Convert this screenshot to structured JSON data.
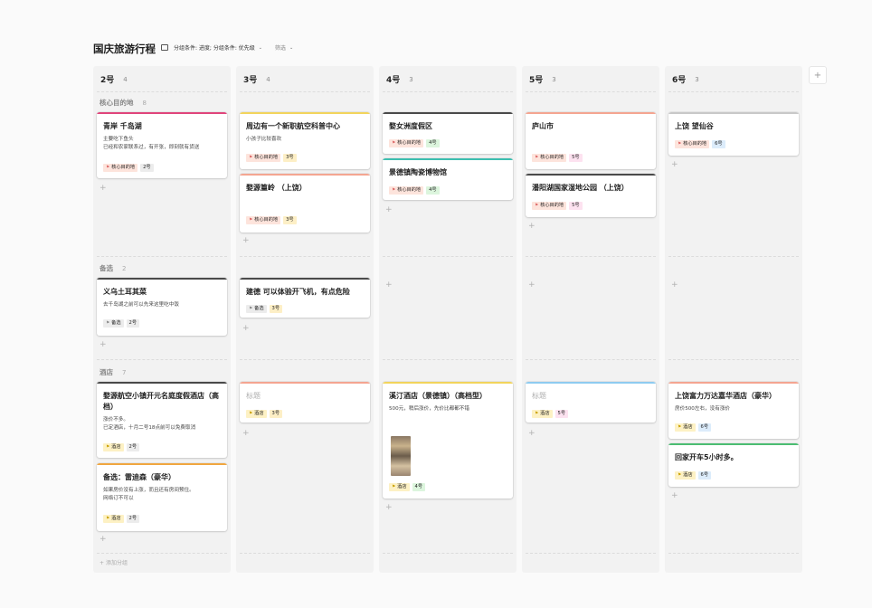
{
  "title": "国庆旅游行程",
  "toolbar": {
    "group_label": "分组条件: 进度; 分组条件: 优先级",
    "filter_label": "筛选"
  },
  "add_group_label": "添加分组",
  "add_symbol": "+",
  "sections": [
    {
      "name": "核心目的地",
      "count": "8"
    },
    {
      "name": "备选",
      "count": "2"
    },
    {
      "name": "酒店",
      "count": "7"
    }
  ],
  "columns": [
    {
      "name": "2号",
      "count": "4",
      "cards": [
        {
          "title": "青岸 千岛湖",
          "desc": [
            "主要吃下鱼头",
            "已经和农家联系过，有开张，即刻就有货送"
          ],
          "tags": [
            "核心目的地",
            "2号"
          ]
        },
        {
          "title": "义乌土耳其菜",
          "desc": [
            "去千岛湖之前可以先来这里吃中饭"
          ],
          "tags": [
            "备选",
            "2号"
          ]
        },
        {
          "title": "婺源航空小镇开元名庭度假酒店（高档）",
          "desc": [
            "涨价不多。",
            "已定酒店，十月二号18点前可以免费取消"
          ],
          "tags": [
            "酒店",
            "2号"
          ]
        },
        {
          "title": "备选：雷迪森（豪华）",
          "desc": [
            "如果房价没有上涨，而且还有房间预住。",
            "网络订不可以"
          ],
          "tags": [
            "酒店",
            "2号"
          ]
        }
      ]
    },
    {
      "name": "3号",
      "count": "4",
      "cards": [
        {
          "title": "周边有一个新职航空科普中心",
          "desc": [
            "小孩子比较喜欢"
          ],
          "tags": [
            "核心目的地",
            "3号"
          ]
        },
        {
          "title": "婺源篁岭 （上饶）",
          "desc": [],
          "tags": [
            "核心目的地",
            "3号"
          ]
        },
        {
          "title": "建德 可以体验开飞机，有点危险",
          "desc": [],
          "tags": [
            "备选",
            "3号"
          ]
        },
        {
          "title": "标题",
          "desc": [],
          "tags": [
            "酒店",
            "3号"
          ]
        }
      ]
    },
    {
      "name": "4号",
      "count": "3",
      "cards": [
        {
          "title": "婺女洲度假区",
          "desc": [],
          "tags": [
            "核心目的地",
            "4号"
          ]
        },
        {
          "title": "景德镇陶瓷博物馆",
          "desc": [],
          "tags": [
            "核心目的地",
            "4号"
          ]
        },
        {
          "title": "溪汀酒店（景德镇）（高档型）",
          "desc": [
            "500元，稍后涨价，先价比都都不错"
          ],
          "tags": [
            "酒店",
            "4号"
          ]
        }
      ]
    },
    {
      "name": "5号",
      "count": "3",
      "cards": [
        {
          "title": "庐山市",
          "desc": [],
          "tags": [
            "核心目的地",
            "5号"
          ]
        },
        {
          "title": "潘阳湖国家湿地公园 （上饶）",
          "desc": [],
          "tags": [
            "核心目的地",
            "5号"
          ]
        },
        {
          "title": "标题",
          "desc": [],
          "tags": [
            "酒店",
            "5号"
          ]
        }
      ]
    },
    {
      "name": "6号",
      "count": "3",
      "cards": [
        {
          "title": "上饶 望仙谷",
          "desc": [],
          "tags": [
            "核心目的地",
            "6号"
          ]
        },
        {
          "title": "上饶富力万达嘉华酒店（豪华）",
          "desc": [
            "房价500左右，没有涨价"
          ],
          "tags": [
            "酒店",
            "6号"
          ]
        },
        {
          "title": "回家开车5小时多。",
          "desc": [],
          "tags": [
            "酒店",
            "6号"
          ]
        }
      ]
    }
  ],
  "colors": {
    "bar_pink": "#e0457b",
    "bar_dark": "#4a4a4a",
    "bar_yellow": "#f2d45c",
    "bar_salmon": "#f4a591",
    "bar_teal": "#3dbfb0",
    "bar_orange": "#f0a640",
    "bar_blue": "#8ecbf0",
    "bar_gray": "#c8c8c8",
    "bar_green": "#4bbd72",
    "tag_core_bg": "#fde4dc",
    "tag_alt_bg": "#ececec",
    "tag_hotel_bg": "#fdf1c4",
    "tag_day2_bg": "#ececec",
    "tag_day3_bg": "#fdefc6",
    "tag_day4_bg": "#dcf5dd",
    "tag_day5_bg": "#fde2f0",
    "tag_day6_bg": "#dcecfb"
  }
}
